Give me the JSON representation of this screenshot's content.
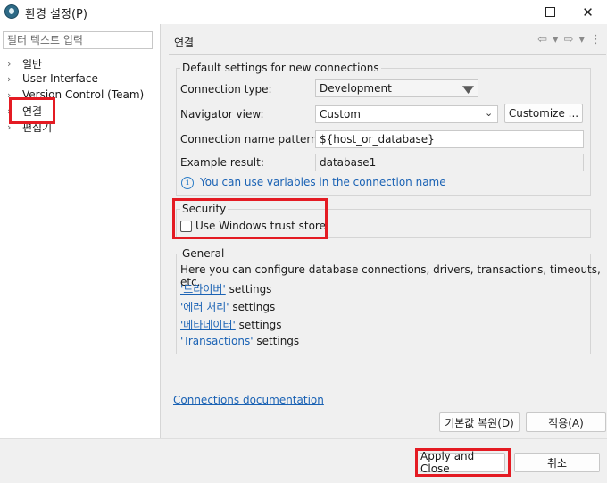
{
  "window": {
    "title": "환경 설정(P)",
    "maximize_icon": "maximize-icon",
    "close_glyph": "✕"
  },
  "sidebar": {
    "filter_placeholder": "필터 텍스트 입력",
    "items": [
      {
        "label": "일반",
        "expandable": true
      },
      {
        "label": "User Interface",
        "expandable": true
      },
      {
        "label": "Version Control (Team)",
        "expandable": true
      },
      {
        "label": "연결",
        "expandable": true,
        "selected": true
      },
      {
        "label": "편집기",
        "expandable": true
      }
    ],
    "arrow": "›"
  },
  "page": {
    "title": "연결",
    "nav": {
      "back": "⇦",
      "back_dropdown": "▾",
      "forward": "⇨",
      "forward_dropdown": "▾",
      "menu": "⋮"
    }
  },
  "defaults_group": {
    "legend": "Default settings for new connections",
    "connection_type_label": "Connection type:",
    "connection_type_value": "Development",
    "navigator_view_label": "Navigator view:",
    "navigator_view_value": "Custom",
    "customize_button": "Customize ...",
    "name_pattern_label": "Connection name pattern:",
    "name_pattern_value": "${host_or_database}",
    "example_result_label": "Example result:",
    "example_result_value": "database1",
    "info_icon": "i",
    "variables_link": "You can use variables in the connection name"
  },
  "security_group": {
    "legend": "Security",
    "trust_store_label": "Use Windows trust store",
    "trust_store_checked": false
  },
  "general_group": {
    "legend": "General",
    "description": "Here you can configure database connections, drivers, transactions, timeouts, etc.",
    "links": [
      {
        "link": "'드라이버'",
        "suffix": " settings"
      },
      {
        "link": "'에러 처리'",
        "suffix": " settings"
      },
      {
        "link": "'메타데이터'",
        "suffix": " settings"
      },
      {
        "link": "'Transactions'",
        "suffix": " settings"
      }
    ]
  },
  "docs_link": "Connections documentation",
  "page_buttons": {
    "restore_defaults": "기본값 복원(D)",
    "apply": "적용(A)"
  },
  "dialog_buttons": {
    "apply_and_close": "Apply and Close",
    "cancel": "취소"
  },
  "colors": {
    "highlight": "#e41b23",
    "link": "#1a62b4"
  }
}
